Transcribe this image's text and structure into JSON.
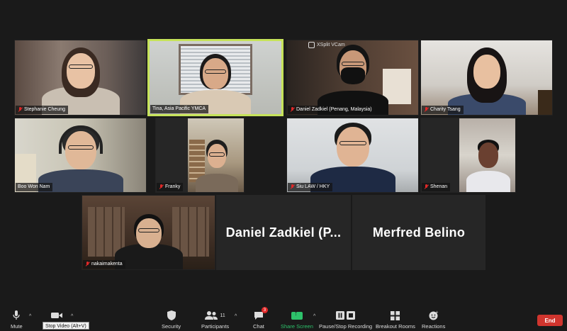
{
  "participants": [
    {
      "name": "Stephanie Cheung",
      "muted": true
    },
    {
      "name": "Tina, Asia Pacific YMCA",
      "muted": false,
      "active": true
    },
    {
      "name": "Daniel Zadkiel (Penang, Malaysia)",
      "muted": true,
      "watermark": "XSplit VCam"
    },
    {
      "name": "Charity Tsang",
      "muted": true
    },
    {
      "name": "Boo Won Nam",
      "muted": false
    },
    {
      "name": "Franky",
      "muted": true
    },
    {
      "name": "Siu LAW / HKY",
      "muted": true
    },
    {
      "name": "Shenan",
      "muted": true
    },
    {
      "name": "nakaimakenta",
      "muted": true
    }
  ],
  "video_off": [
    {
      "name": "Daniel Zadkiel (P..."
    },
    {
      "name": "Merfred Belino"
    }
  ],
  "toolbar": {
    "mute_label": "Mute",
    "stop_video_label": "Stop Video",
    "stop_video_tooltip": "Stop Video (Alt+V)",
    "security_label": "Security",
    "participants_label": "Participants",
    "participants_count": "11",
    "chat_label": "Chat",
    "chat_badge": "3",
    "share_label": "Share Screen",
    "record_label": "Pause/Stop Recording",
    "breakout_label": "Breakout Rooms",
    "reactions_label": "Reactions",
    "end_label": "End"
  },
  "colors": {
    "active_speaker_border": "#c6e35a",
    "share_green": "#2ec26b",
    "end_red": "#d0352e",
    "muted_red": "#e02828"
  }
}
